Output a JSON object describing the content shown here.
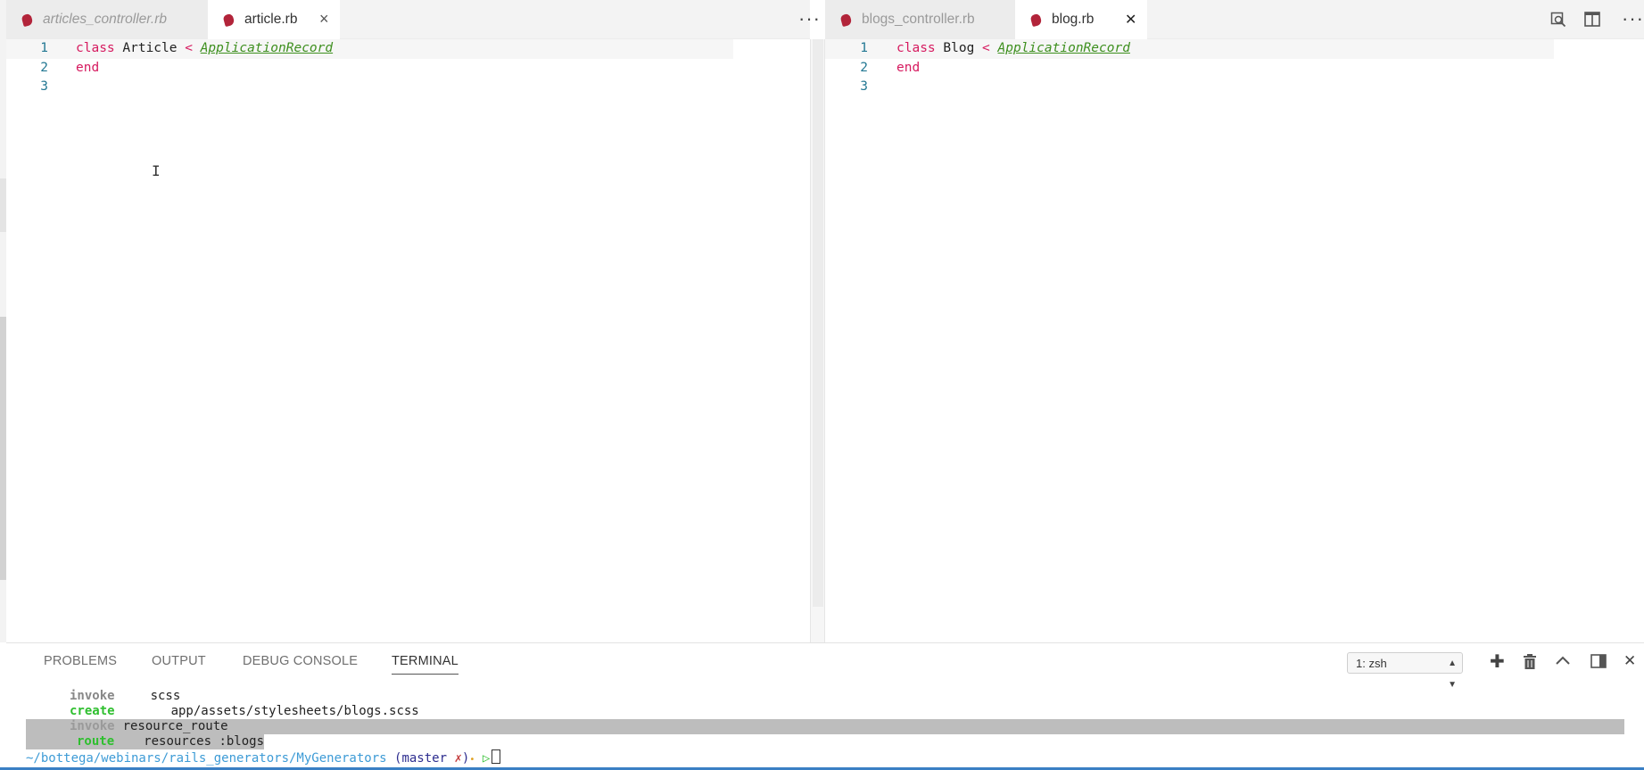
{
  "editor_left": {
    "tabs": [
      {
        "label": "articles_controller.rb",
        "active": false
      },
      {
        "label": "article.rb",
        "active": true
      }
    ],
    "close_glyph": "×",
    "more_glyph": "···",
    "lines": [
      {
        "num": "1",
        "kw": "class",
        "name": "Article",
        "op": "<",
        "super": "ApplicationRecord"
      },
      {
        "num": "2",
        "end": "end"
      },
      {
        "num": "3"
      }
    ]
  },
  "editor_right": {
    "tabs": [
      {
        "label": "blogs_controller.rb",
        "active": false
      },
      {
        "label": "blog.rb",
        "active": true
      }
    ],
    "close_glyph": "✕",
    "more_glyph": "···",
    "lines": [
      {
        "num": "1",
        "kw": "class",
        "name": "Blog",
        "op": "<",
        "super": "ApplicationRecord"
      },
      {
        "num": "2",
        "end": "end"
      },
      {
        "num": "3"
      }
    ]
  },
  "icons": {
    "editor_cursor": "I-beam-cursor-icon",
    "open_changes": "search-changes-icon",
    "split_editor": "split-editor-icon",
    "more_actions": "ellipsis-icon"
  },
  "panel": {
    "tabs": [
      "PROBLEMS",
      "OUTPUT",
      "DEBUG CONSOLE",
      "TERMINAL"
    ],
    "active_tab": "TERMINAL",
    "shell_select": "1: zsh",
    "terminal": [
      {
        "verb": "invoke",
        "arg": "scss"
      },
      {
        "verb": "create",
        "arg": "app/assets/stylesheets/blogs.scss"
      },
      {
        "verb": "invoke",
        "arg": "resource_route"
      },
      {
        "verb": "route",
        "arg": "resources :blogs"
      }
    ],
    "prompt": {
      "path": "~/bottega/webinars/rails_generators/MyGenerators",
      "branch_open": "(master",
      "dirty": "✗",
      "branch_close": ")",
      "arrow": "▷"
    }
  },
  "colors": {
    "keyword": "#d61a5f",
    "superclass": "#3d8f1e",
    "line_number": "#237893",
    "status_bar": "#3a7fc4"
  }
}
